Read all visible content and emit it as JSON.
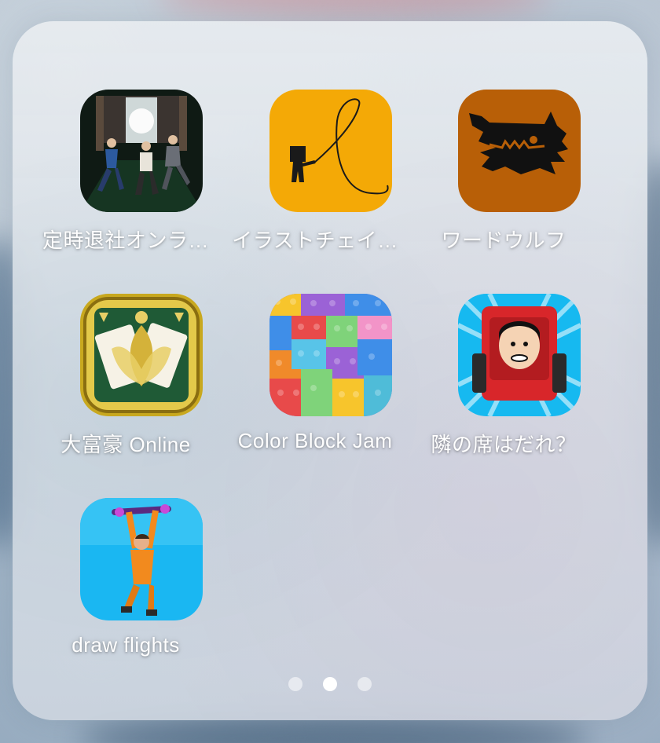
{
  "folder": {
    "apps": [
      {
        "id": "teiji-taisha",
        "label": "定時退社オンラ…"
      },
      {
        "id": "illust-chain",
        "label": "イラストチェイ…"
      },
      {
        "id": "word-wolf",
        "label": "ワードウルフ"
      },
      {
        "id": "daifugo",
        "label": "大富豪 Online"
      },
      {
        "id": "color-block-jam",
        "label": "Color Block Jam"
      },
      {
        "id": "tonari-no-seki",
        "label": "隣の席はだれ？"
      },
      {
        "id": "draw-flights",
        "label": "draw flights"
      }
    ],
    "page_indicator": {
      "pages": 3,
      "current": 2
    }
  },
  "colors": {
    "illust_bg": "#f4a906",
    "wolf_bg": "#b85f07",
    "jam_bg": "#7f62c8",
    "tonari_bg": "#16b9f0",
    "flights_bg": "#1ab7f2"
  }
}
